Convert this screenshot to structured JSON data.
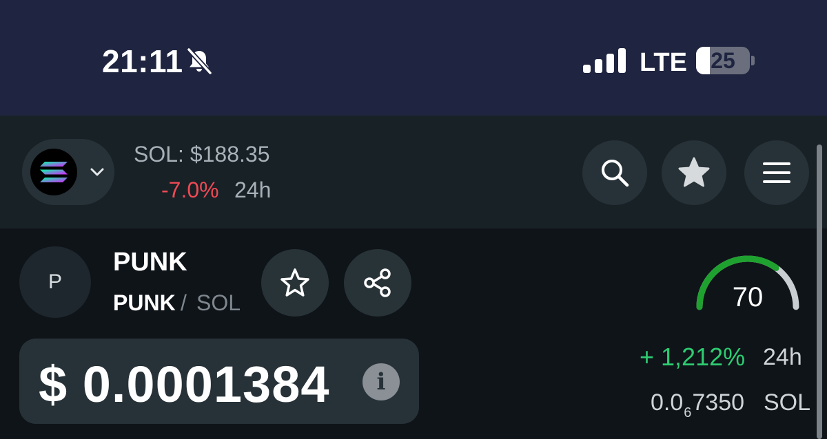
{
  "status_bar": {
    "time": "21:11",
    "network": "LTE",
    "battery": "25",
    "battery_level": 0.25,
    "icons": [
      "bell-muted-icon",
      "signal-icon"
    ]
  },
  "header": {
    "chain": "SOL",
    "sol_price": "SOL: $188.35",
    "sol_change": "-7.0%",
    "sol_period": "24h",
    "icons": [
      "solana-logo-icon",
      "chevron-down-icon",
      "search-icon",
      "star-filled-icon",
      "menu-icon"
    ]
  },
  "token": {
    "avatar_letter": "P",
    "name": "PUNK",
    "pair_base": "PUNK",
    "pair_sep": "/",
    "pair_quote": "SOL",
    "price": "$ 0.0001384",
    "info_glyph": "i",
    "icons": [
      "star-outline-icon",
      "share-icon",
      "info-icon"
    ]
  },
  "score": {
    "value": "70",
    "level": 0.7
  },
  "stats": {
    "change": "+ 1,212%",
    "change_period": "24h",
    "sol_prefix": "0.0",
    "sol_zero_count": "6",
    "sol_digits": "7350",
    "sol_unit": "SOL"
  },
  "colors": {
    "status_bg": "#1f2540",
    "header_bg": "#182126",
    "body_bg": "#0f1419",
    "negative": "#ef4a55",
    "positive": "#2ecc71",
    "gauge_green": "#1fa12f"
  }
}
